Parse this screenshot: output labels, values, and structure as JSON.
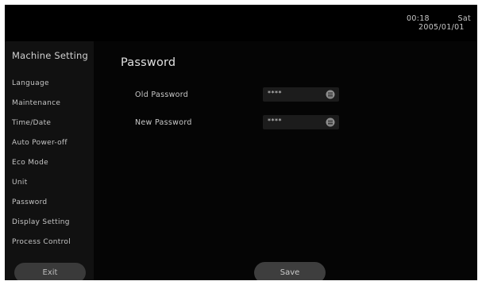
{
  "status_bar": {
    "time": "00:18",
    "day": "Sat",
    "date": "2005/01/01"
  },
  "sidebar": {
    "title": "Machine Setting",
    "items": [
      {
        "label": "Language"
      },
      {
        "label": "Maintenance"
      },
      {
        "label": "Time/Date"
      },
      {
        "label": "Auto Power-off"
      },
      {
        "label": "Eco Mode"
      },
      {
        "label": "Unit"
      },
      {
        "label": "Password"
      },
      {
        "label": "Display Setting"
      },
      {
        "label": "Process Control"
      }
    ],
    "exit_label": "Exit"
  },
  "main": {
    "title": "Password",
    "fields": [
      {
        "label": "Old Password",
        "value": "****",
        "icon": "keyboard-icon"
      },
      {
        "label": "New Password",
        "value": "****",
        "icon": "keyboard-icon"
      }
    ],
    "save_label": "Save"
  }
}
